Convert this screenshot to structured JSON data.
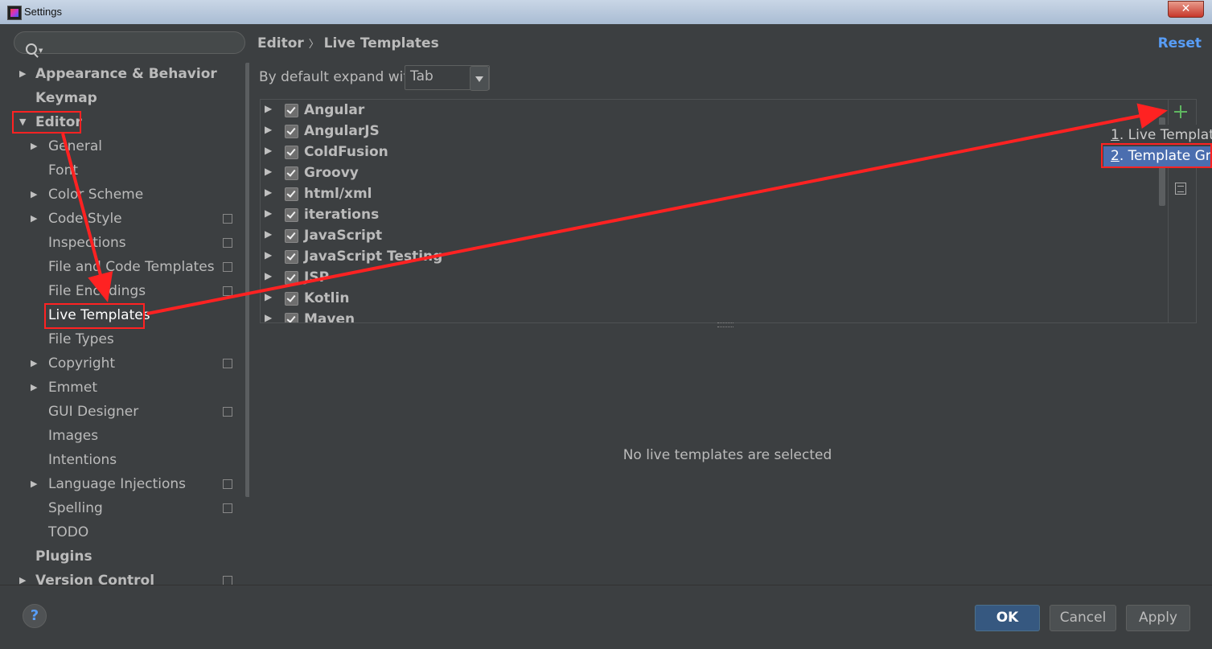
{
  "window": {
    "title": "Settings",
    "close_glyph": "✕"
  },
  "sidebar": {
    "search": {
      "placeholder": "",
      "icon": "search-icon"
    },
    "items": [
      {
        "label": "Appearance & Behavior",
        "level": 0,
        "bold": true,
        "expandable": true
      },
      {
        "label": "Keymap",
        "level": 0,
        "bold": true,
        "expandable": false
      },
      {
        "label": "Editor",
        "level": 0,
        "bold": true,
        "expandable": true,
        "expanded": true
      },
      {
        "label": "General",
        "level": 1,
        "expandable": true
      },
      {
        "label": "Font",
        "level": 1
      },
      {
        "label": "Color Scheme",
        "level": 1,
        "expandable": true
      },
      {
        "label": "Code Style",
        "level": 1,
        "expandable": true,
        "project_icon": true
      },
      {
        "label": "Inspections",
        "level": 1,
        "project_icon": true
      },
      {
        "label": "File and Code Templates",
        "level": 1,
        "project_icon": true
      },
      {
        "label": "File Encodings",
        "level": 1,
        "project_icon": true
      },
      {
        "label": "Live Templates",
        "level": 1,
        "selected": true
      },
      {
        "label": "File Types",
        "level": 1
      },
      {
        "label": "Copyright",
        "level": 1,
        "expandable": true,
        "project_icon": true
      },
      {
        "label": "Emmet",
        "level": 1,
        "expandable": true
      },
      {
        "label": "GUI Designer",
        "level": 1,
        "project_icon": true
      },
      {
        "label": "Images",
        "level": 1
      },
      {
        "label": "Intentions",
        "level": 1
      },
      {
        "label": "Language Injections",
        "level": 1,
        "expandable": true,
        "project_icon": true
      },
      {
        "label": "Spelling",
        "level": 1,
        "project_icon": true
      },
      {
        "label": "TODO",
        "level": 1
      },
      {
        "label": "Plugins",
        "level": 0,
        "bold": true
      },
      {
        "label": "Version Control",
        "level": 0,
        "bold": true,
        "expandable": true,
        "project_icon": true
      }
    ]
  },
  "main": {
    "breadcrumb": {
      "parent": "Editor",
      "separator": "〉",
      "current": "Live Templates"
    },
    "reset_label": "Reset",
    "expand": {
      "label": "By default expand with",
      "value": "Tab"
    },
    "groups": [
      "Angular",
      "AngularJS",
      "ColdFusion",
      "Groovy",
      "html/xml",
      "iterations",
      "JavaScript",
      "JavaScript Testing",
      "JSP",
      "Kotlin",
      "Maven"
    ],
    "empty_message": "No live templates are selected",
    "add_menu": [
      {
        "number": "1",
        "label": ". Live Template",
        "selected": false
      },
      {
        "number": "2",
        "label": ". Template Gro",
        "selected": true
      }
    ]
  },
  "footer": {
    "help_label": "?",
    "ok_label": "OK",
    "cancel_label": "Cancel",
    "apply_label": "Apply"
  },
  "colors": {
    "background": "#3c3f41",
    "selection": "#4b6eaf",
    "link": "#589df6",
    "annotation": "#ff2222",
    "add_icon": "#5fb760"
  }
}
